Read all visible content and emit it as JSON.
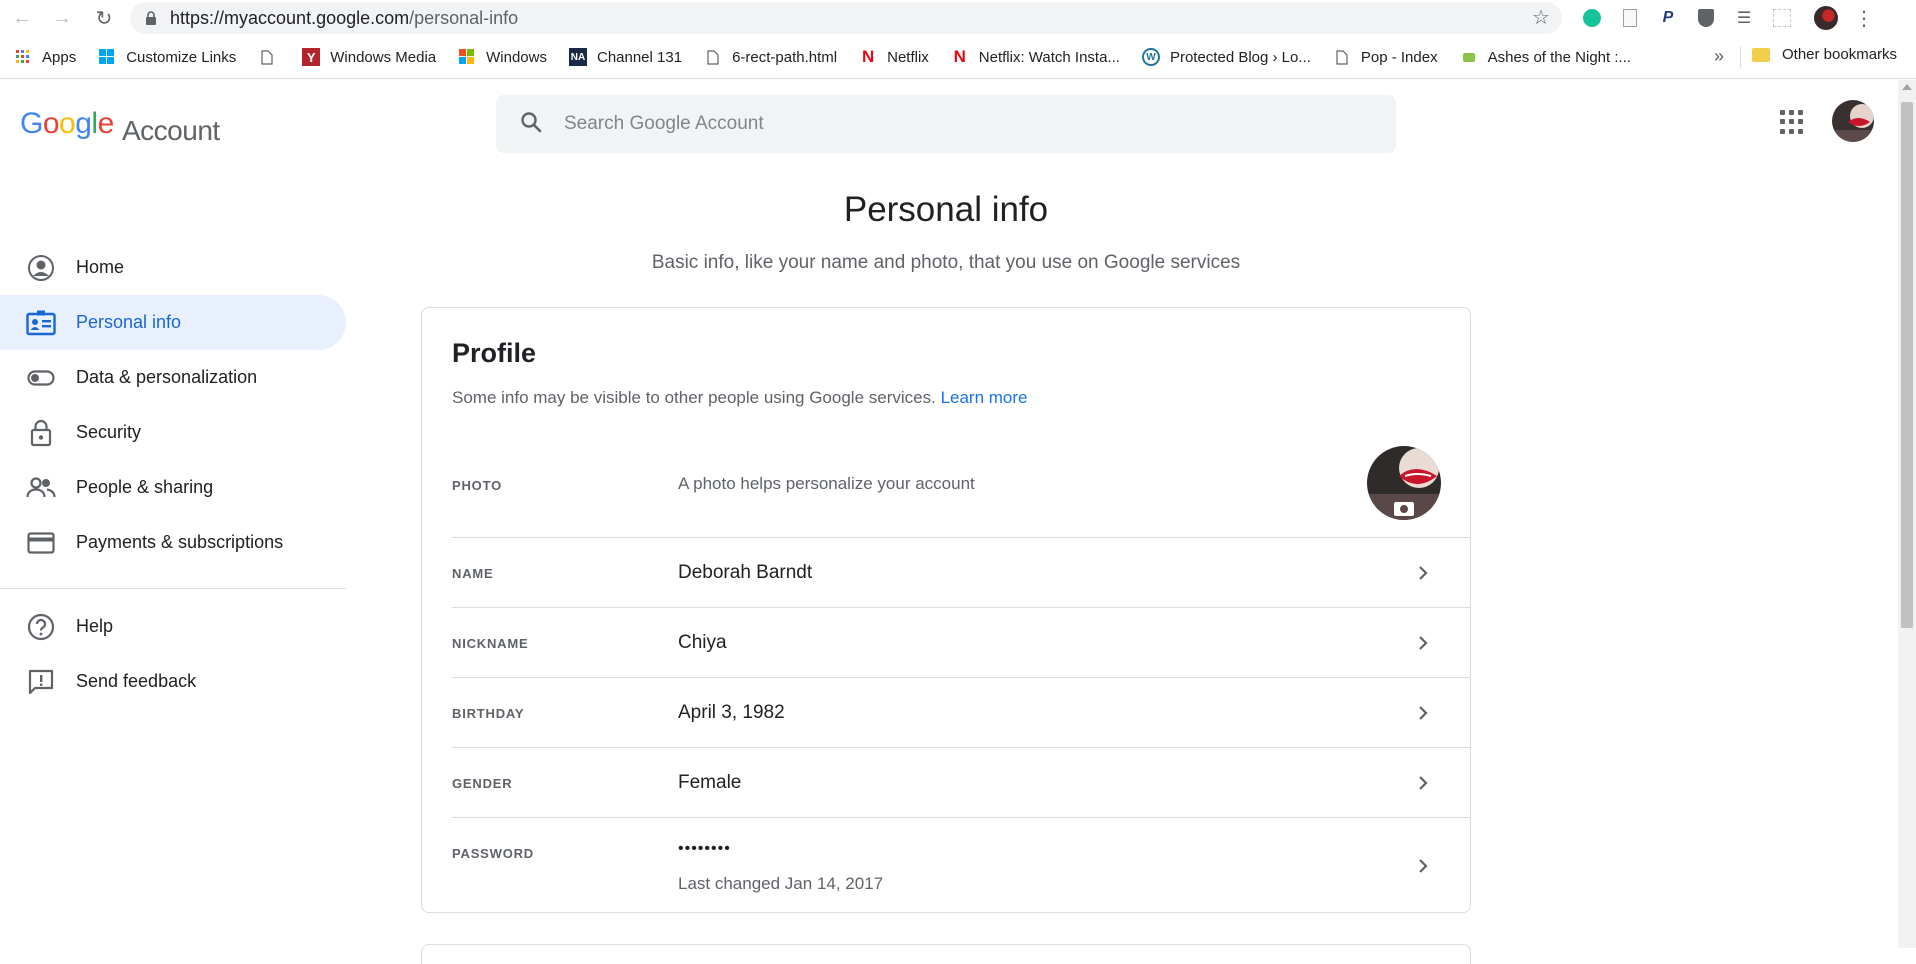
{
  "browser": {
    "url_host": "https://myaccount.google.com",
    "url_path": "/personal-info",
    "bookmarks": [
      {
        "label": "Apps",
        "icon": "apps-grid-icon"
      },
      {
        "label": "Customize Links",
        "icon": "windows-logo-icon"
      },
      {
        "label": "",
        "icon": "page-icon"
      },
      {
        "label": "Windows Media",
        "icon": "windows-media-icon"
      },
      {
        "label": "Windows",
        "icon": "windows-logo-icon"
      },
      {
        "label": "Channel 131",
        "icon": "na-logo-icon"
      },
      {
        "label": "6-rect-path.html",
        "icon": "page-icon"
      },
      {
        "label": "Netflix",
        "icon": "netflix-icon"
      },
      {
        "label": "Netflix: Watch Insta...",
        "icon": "netflix-icon"
      },
      {
        "label": "Protected Blog › Lo...",
        "icon": "wordpress-icon"
      },
      {
        "label": "Pop - Index",
        "icon": "page-icon"
      },
      {
        "label": "Ashes of the Night :...",
        "icon": "chat-icon"
      }
    ],
    "more_label": "»",
    "other_bookmarks": "Other bookmarks"
  },
  "header": {
    "logo_account": "Account",
    "search_placeholder": "Search Google Account"
  },
  "sidebar": {
    "items": [
      {
        "label": "Home",
        "icon": "account-circle-icon",
        "active": false
      },
      {
        "label": "Personal info",
        "icon": "id-card-icon",
        "active": true
      },
      {
        "label": "Data & personalization",
        "icon": "toggle-icon",
        "active": false
      },
      {
        "label": "Security",
        "icon": "lock-icon",
        "active": false
      },
      {
        "label": "People & sharing",
        "icon": "people-icon",
        "active": false
      },
      {
        "label": "Payments & subscriptions",
        "icon": "credit-card-icon",
        "active": false
      }
    ],
    "secondary": [
      {
        "label": "Help",
        "icon": "help-icon"
      },
      {
        "label": "Send feedback",
        "icon": "feedback-icon"
      }
    ]
  },
  "main": {
    "title": "Personal info",
    "subtitle": "Basic info, like your name and photo, that you use on Google services",
    "profile": {
      "title": "Profile",
      "description": "Some info may be visible to other people using Google services.",
      "learn_more": "Learn more",
      "rows": {
        "photo": {
          "label": "PHOTO",
          "value": "A photo helps personalize your account"
        },
        "name": {
          "label": "NAME",
          "value": "Deborah Barndt"
        },
        "nickname": {
          "label": "NICKNAME",
          "value": "Chiya"
        },
        "birthday": {
          "label": "BIRTHDAY",
          "value": "April 3, 1982"
        },
        "gender": {
          "label": "GENDER",
          "value": "Female"
        },
        "password": {
          "label": "PASSWORD",
          "value": "••••••••",
          "note": "Last changed Jan 14, 2017"
        }
      }
    }
  },
  "colors": {
    "accent": "#1a73e8",
    "active_bg": "#e8f0fe",
    "active_text": "#1967d2"
  }
}
